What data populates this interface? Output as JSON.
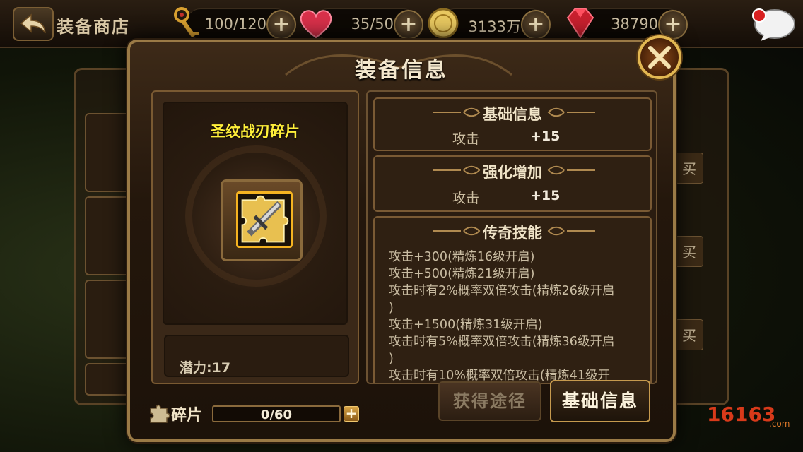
{
  "topbar": {
    "title": "装备商店",
    "resources": [
      {
        "icon": "key-icon",
        "value": "100/120"
      },
      {
        "icon": "heart-icon",
        "value": "35/50"
      },
      {
        "icon": "gold-coin-icon",
        "value": "3133万"
      },
      {
        "icon": "ruby-gem-icon",
        "value": "38790"
      }
    ],
    "plus_label": "+"
  },
  "background_list": {
    "buy_label": "买"
  },
  "dialog": {
    "title": "装备信息",
    "item": {
      "name": "圣纹战刃碎片",
      "potential_label": "潜力:",
      "potential_value": "17"
    },
    "sections": {
      "basic": {
        "title": "基础信息",
        "stat_name": "攻击",
        "stat_value": "+15"
      },
      "enhance": {
        "title": "强化增加",
        "stat_name": "攻击",
        "stat_value": "+15"
      },
      "legend": {
        "title": "传奇技能",
        "lines": [
          "攻击+300(精炼16级开启)",
          "攻击+500(精炼21级开启)",
          "攻击时有2%概率双倍攻击(精炼26级开启",
          ")",
          "攻击+1500(精炼31级开启)",
          "攻击时有5%概率双倍攻击(精炼36级开启",
          ")",
          "攻击时有10%概率双倍攻击(精炼41级开"
        ]
      }
    },
    "fragments": {
      "label": "碎片",
      "progress_text": "0/60",
      "current": 0,
      "max": 60,
      "plus_label": "+"
    },
    "buttons": {
      "obtain": "获得途径",
      "basic": "基础信息"
    }
  },
  "watermark": {
    "text": "16163",
    "sub": ".com"
  },
  "colors": {
    "item_name": "#ffef3a",
    "frame_gold": "#f5b321",
    "accent_border": "#9a7a46"
  }
}
